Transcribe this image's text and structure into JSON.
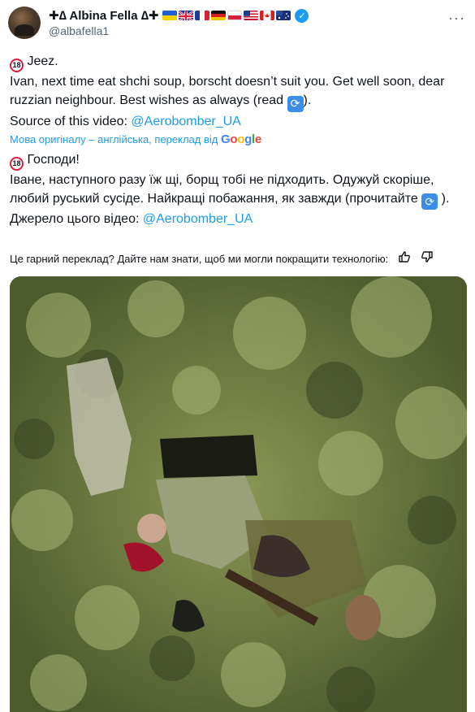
{
  "header": {
    "display_name_prefix": "✚∆ Albina Fella ∆✚",
    "handle": "@albafella1",
    "verified_icon": "checkmark-icon",
    "flags": [
      "ukraine",
      "united-kingdom",
      "france",
      "germany",
      "poland",
      "united-states",
      "canada",
      "australia"
    ]
  },
  "tweet": {
    "original_lines": [
      "Jeez.",
      "Ivan, next time eat shchi soup, borscht doesn’t suit you. Get well soon, dear ruzzian neighbour. Best wishes as always  (read ",
      ")."
    ],
    "source_label": "Source of this video: ",
    "source_link": "@Aerobomber_UA",
    "translation_note": "Мова оригіналу – англійська, переклад від",
    "translation_provider_letters": [
      "G",
      "o",
      "o",
      "g",
      "l",
      "e"
    ],
    "translated_lines": [
      "Господи!",
      "Іване, наступного разу їж щі, борщ тобі не підходить. Одужуй скоріше, любий руський сусіде. Найкращі побажання, як завжди (прочитайте ",
      " )."
    ],
    "translated_source_label": "Джерело цього відео: ",
    "translated_source_link": "@Aerobomber_UA",
    "badge_text": "18"
  },
  "feedback": {
    "prompt": "Це гарний переклад? Дайте нам знати, щоб ми могли покращити технологію:",
    "thumbs_up_icon": "thumbs-up-icon",
    "thumbs_down_icon": "thumbs-down-icon"
  },
  "media": {
    "type": "video-still",
    "colors": {
      "foliage": "#6f7b3f",
      "dark": "#2e3320",
      "highlight": "#b9c38a",
      "accent": "#a3122b"
    }
  }
}
